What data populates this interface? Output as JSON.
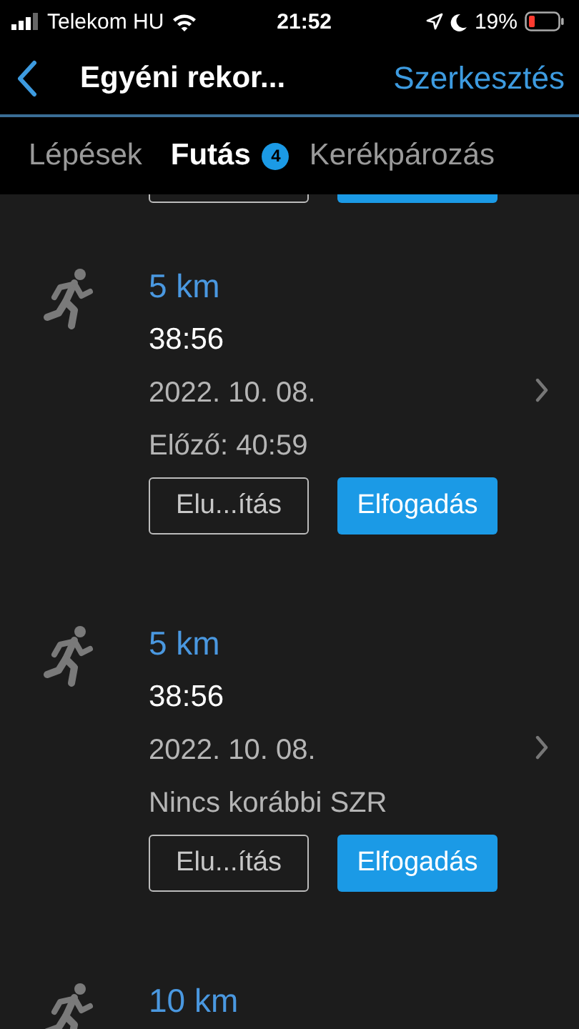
{
  "status_bar": {
    "carrier": "Telekom HU",
    "time": "21:52",
    "battery": "19%"
  },
  "nav": {
    "title": "Egyéni rekor...",
    "action": "Szerkesztés"
  },
  "tabs": [
    {
      "label": "Lépések",
      "selected": false
    },
    {
      "label": "Futás",
      "selected": true,
      "badge": "4"
    },
    {
      "label": "Kerékpározás",
      "selected": false
    }
  ],
  "records": [
    {
      "distance": "5 km",
      "time": "38:56",
      "date": "2022. 10. 08.",
      "note": "Előző: 40:59",
      "buttons": [
        "Elu...ítás",
        "Elfogadás"
      ]
    },
    {
      "distance": "5 km",
      "time": "38:56",
      "date": "2022. 10. 08.",
      "note": "Nincs korábbi SZR",
      "buttons": [
        "Elu...ítás",
        "Elfogadás"
      ]
    },
    {
      "distance": "10 km"
    }
  ]
}
